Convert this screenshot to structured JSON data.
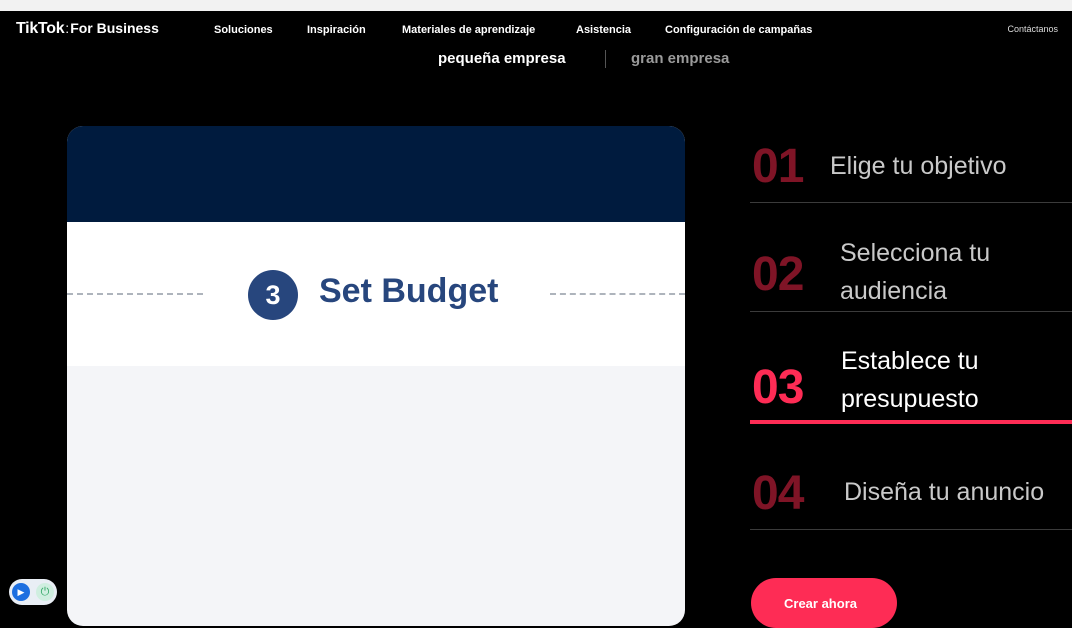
{
  "brand": {
    "name": "TikTok",
    "separator": ":",
    "product": "For Business"
  },
  "nav": {
    "items": [
      "Soluciones",
      "Inspiración",
      "Materiales de aprendizaje",
      "Asistencia",
      "Configuración de campañas"
    ],
    "contact": "Contáctanos"
  },
  "segment": {
    "small": "pequeña empresa",
    "large": "gran empresa"
  },
  "panel": {
    "step_number": "3",
    "step_title": "Set Budget"
  },
  "steps": [
    {
      "number": "01",
      "label": "Elige tu objetivo",
      "active": false
    },
    {
      "number": "02",
      "label": "Selecciona tu audiencia",
      "active": false
    },
    {
      "number": "03",
      "label": "Establece tu presupuesto",
      "active": true
    },
    {
      "number": "04",
      "label": "Diseña tu anuncio",
      "active": false
    }
  ],
  "cta": {
    "label": "Crear ahora"
  },
  "colors": {
    "accent": "#fe2c55",
    "panel_header": "#001b3e",
    "budget_blue": "#27467d"
  },
  "icons": {
    "widget_left": "play-icon",
    "widget_right": "power-icon"
  }
}
